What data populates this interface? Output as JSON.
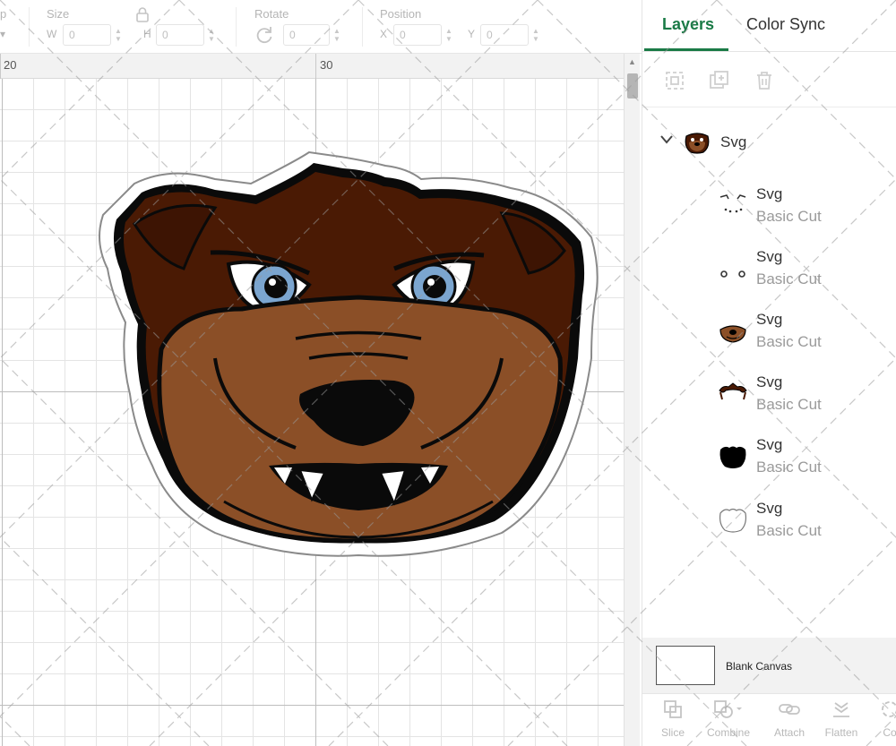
{
  "toolbar": {
    "partial_label": "p",
    "size_label": "Size",
    "width_letter": "W",
    "width_value": "0",
    "height_letter": "H",
    "height_value": "0",
    "rotate_label": "Rotate",
    "rotate_value": "0",
    "position_label": "Position",
    "x_letter": "X",
    "x_value": "0",
    "y_letter": "Y",
    "y_value": "0"
  },
  "ruler": {
    "marks": [
      "20",
      "30"
    ]
  },
  "panel": {
    "tabs": [
      {
        "label": "Layers",
        "active": true
      },
      {
        "label": "Color Sync",
        "active": false
      }
    ],
    "actions": [
      {
        "icon": "group-icon"
      },
      {
        "icon": "duplicate-icon"
      },
      {
        "icon": "delete-icon"
      }
    ],
    "group": {
      "name": "Svg",
      "icon": "chevron-down-icon"
    },
    "layers": [
      {
        "name": "Svg",
        "type": "Basic Cut",
        "thumb": "eye-details"
      },
      {
        "name": "Svg",
        "type": "Basic Cut",
        "thumb": "pupils"
      },
      {
        "name": "Svg",
        "type": "Basic Cut",
        "thumb": "muzzle"
      },
      {
        "name": "Svg",
        "type": "Basic Cut",
        "thumb": "fur"
      },
      {
        "name": "Svg",
        "type": "Basic Cut",
        "thumb": "black-outline"
      },
      {
        "name": "Svg",
        "type": "Basic Cut",
        "thumb": "white-offset"
      }
    ],
    "blank_canvas": "Blank Canvas",
    "bottom_actions": [
      {
        "label": "Slice",
        "icon": "slice-icon"
      },
      {
        "label": "Combine",
        "icon": "combine-icon"
      },
      {
        "label": "Attach",
        "icon": "attach-icon"
      },
      {
        "label": "Flatten",
        "icon": "flatten-icon"
      },
      {
        "label": "Co",
        "icon": "contour-icon"
      }
    ]
  },
  "colors": {
    "accent": "#1a7a46",
    "fur_dark": "#4a1a04",
    "fur_light": "#8b4f27",
    "eye_iris": "#7ba5cf"
  }
}
